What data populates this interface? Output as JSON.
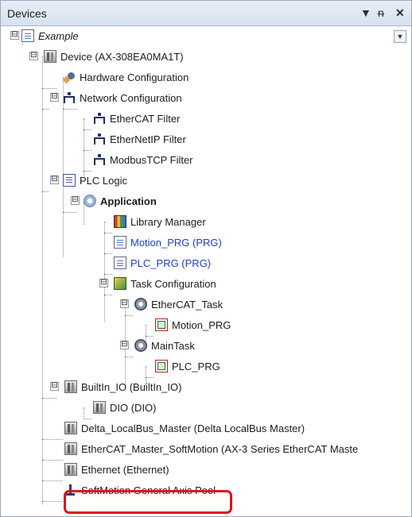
{
  "panel": {
    "title": "Devices",
    "buttons": {
      "dropdown": "▼",
      "pin": "ᵰ",
      "close": "✕"
    }
  },
  "tree": {
    "items": [
      {
        "label": "Example",
        "icon": "project-icon",
        "expander": "⊟"
      },
      {
        "label": "Device (AX-308EA0MA1T)",
        "icon": "device-icon",
        "expander": "⊟"
      },
      {
        "label": "Hardware Configuration",
        "icon": "hardware-config-icon"
      },
      {
        "label": "Network Configuration",
        "icon": "network-icon",
        "expander": "⊟"
      },
      {
        "label": "EtherCAT Filter",
        "icon": "network-icon"
      },
      {
        "label": "EtherNetIP Filter",
        "icon": "network-icon"
      },
      {
        "label": "ModbusTCP Filter",
        "icon": "network-icon"
      },
      {
        "label": "PLC Logic",
        "icon": "plc-logic-icon",
        "expander": "⊟"
      },
      {
        "label": "Application",
        "icon": "application-icon",
        "expander": "⊟"
      },
      {
        "label": "Library Manager",
        "icon": "library-icon"
      },
      {
        "label": "Motion_PRG (PRG)",
        "icon": "program-page-icon"
      },
      {
        "label": "PLC_PRG (PRG)",
        "icon": "program-page-icon"
      },
      {
        "label": "Task Configuration",
        "icon": "task-config-icon",
        "expander": "⊟"
      },
      {
        "label": "EtherCAT_Task",
        "icon": "task-icon",
        "expander": "⊟"
      },
      {
        "label": "Motion_PRG",
        "icon": "program-call-icon"
      },
      {
        "label": "MainTask",
        "icon": "task-icon",
        "expander": "⊟"
      },
      {
        "label": "PLC_PRG",
        "icon": "program-call-icon"
      },
      {
        "label": "BuiltIn_IO (BuiltIn_IO)",
        "icon": "device-icon",
        "expander": "⊟"
      },
      {
        "label": "DIO (DIO)",
        "icon": "device-icon"
      },
      {
        "label": "Delta_LocalBus_Master (Delta LocalBus Master)",
        "icon": "device-icon"
      },
      {
        "label": "EtherCAT_Master_SoftMotion (AX-3 Series EtherCAT Maste",
        "icon": "device-icon"
      },
      {
        "label": "Ethernet (Ethernet)",
        "icon": "device-icon"
      },
      {
        "label": "SoftMotion General Axis Pool",
        "icon": "axis-pool-icon"
      }
    ]
  },
  "colors": {
    "highlight": "#e0101a",
    "link_blue": "#1a3fc7",
    "title_bg": "#dde5f1"
  }
}
